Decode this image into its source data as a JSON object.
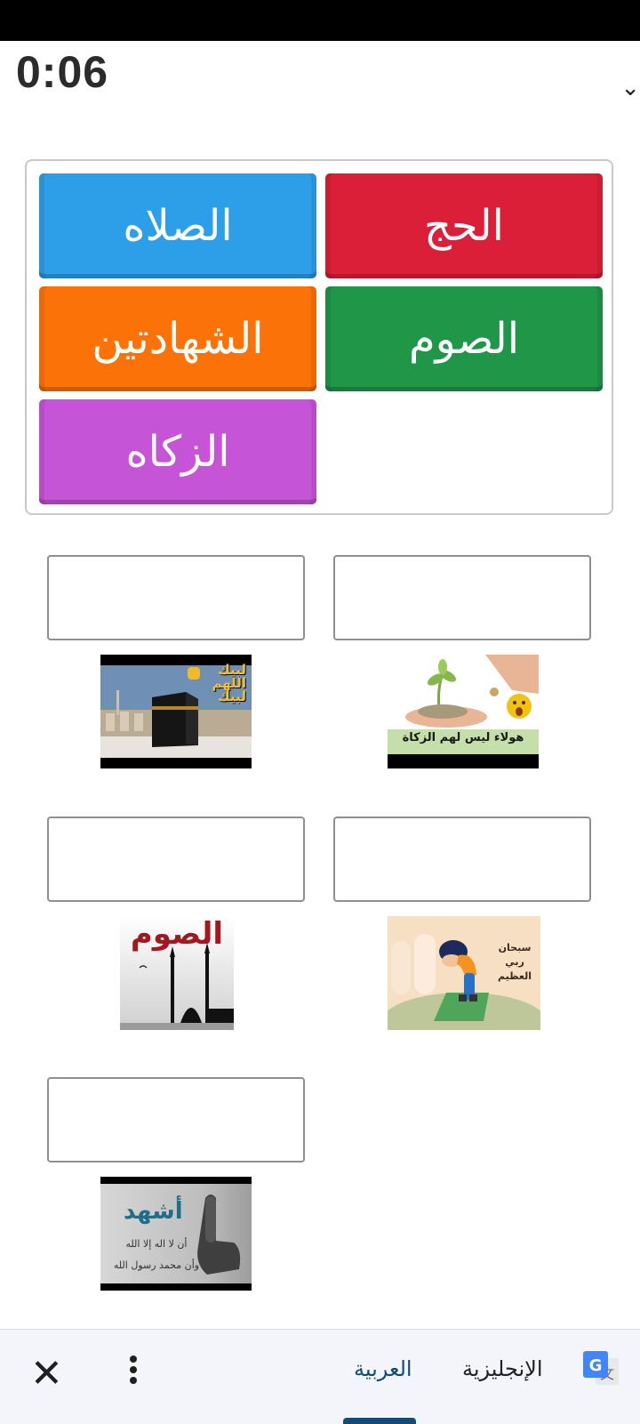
{
  "timer": "0:06",
  "word_bank": {
    "tiles": [
      {
        "label": "الحج",
        "color": "#dc1f38"
      },
      {
        "label": "الصلاه",
        "color": "#2d9ee8"
      },
      {
        "label": "الصوم",
        "color": "#1f9648"
      },
      {
        "label": "الشهادتين",
        "color": "#fb7208"
      },
      {
        "label": "الزكاه",
        "color": "#c654d6"
      }
    ]
  },
  "images": {
    "hajj": {
      "lines": [
        "لبيك",
        "اللهم",
        "لبيك"
      ]
    },
    "zakat": {
      "caption": "هولاء ليس لهم الزكاة"
    },
    "sawm": {
      "title": "الصوم"
    },
    "salah": {
      "lines": [
        "سبحان",
        "ربي",
        "العظيم"
      ]
    },
    "shahada": {
      "title": "أشهد",
      "lines": [
        "أن لا اله إلا الله",
        "وأن محمد رسول الله"
      ]
    }
  },
  "translate_bar": {
    "close_icon": "close-icon",
    "more_icon": "more-vert-icon",
    "lang_current": "العربية",
    "lang_target": "الإنجليزية",
    "accent": "#114b7a"
  }
}
